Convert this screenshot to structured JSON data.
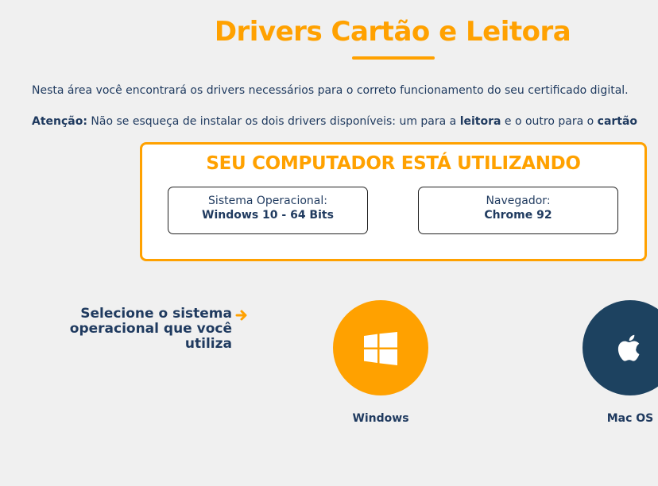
{
  "header": {
    "title": "Drivers Cartão e Leitora"
  },
  "intro": {
    "text": "Nesta área você encontrará os drivers necessários para o correto funcionamento do seu certificado digital."
  },
  "attention": {
    "label": "Atenção:",
    "text_before": " Não se esqueça de instalar os dois drivers disponíveis: um para a ",
    "bold_1": "leitora",
    "text_middle": " e o outro para o ",
    "bold_2": "cartão"
  },
  "system_info": {
    "title": "SEU COMPUTADOR ESTÁ UTILIZANDO",
    "os_label": "Sistema Operacional:",
    "os_value": "Windows 10 - 64 Bits",
    "browser_label": "Navegador:",
    "browser_value": "Chrome 92"
  },
  "selector": {
    "prompt": "Selecione o sistema operacional que você utiliza",
    "options": [
      {
        "label": "Windows",
        "icon": "windows-icon"
      },
      {
        "label": "Mac OS",
        "icon": "apple-icon"
      }
    ]
  },
  "colors": {
    "accent": "#ffa100",
    "text": "#1f3a5f",
    "mac_bg": "#1d4260",
    "background": "#f0f0f0"
  }
}
